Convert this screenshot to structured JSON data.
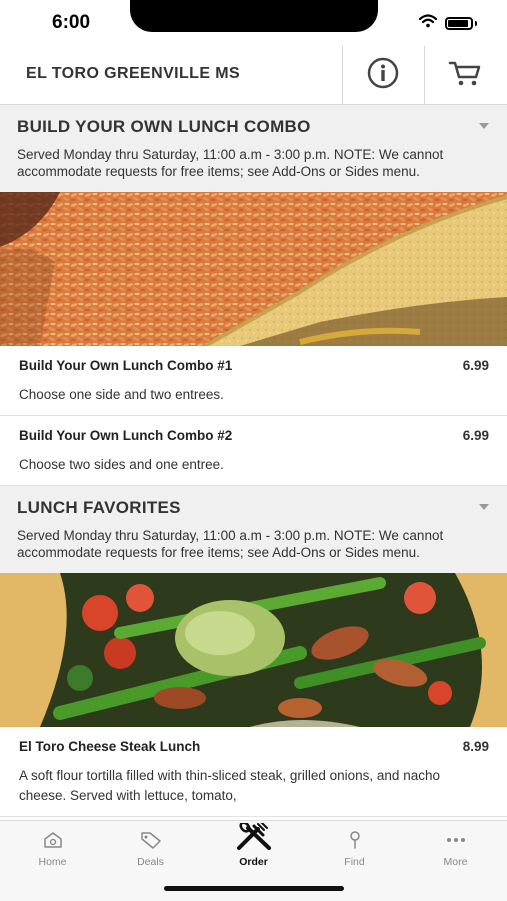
{
  "status_bar": {
    "time": "6:00"
  },
  "header": {
    "title": "EL TORO GREENVILLE MS",
    "info_icon": "info-icon",
    "cart_icon": "cart-icon"
  },
  "sections": [
    {
      "title": "BUILD YOUR OWN LUNCH COMBO",
      "description": "Served Monday thru Saturday, 11:00 a.m - 3:00 p.m. NOTE: We cannot accommodate requests for free items; see Add-Ons or Sides menu.",
      "items": [
        {
          "name": "Build Your Own Lunch Combo #1",
          "price": "6.99",
          "description": "Choose one side and two entrees."
        },
        {
          "name": "Build Your Own Lunch Combo #2",
          "price": "6.99",
          "description": "Choose two sides and one entree."
        }
      ]
    },
    {
      "title": "LUNCH FAVORITES",
      "description": "Served Monday thru Saturday, 11:00 a.m - 3:00 p.m. NOTE: We cannot accommodate requests for free items; see Add-Ons or Sides menu.",
      "items": [
        {
          "name": "El Toro Cheese Steak Lunch",
          "price": "8.99",
          "description": "A soft flour tortilla filled with thin-sliced steak, grilled onions, and nacho cheese. Served with lettuce, tomato,"
        }
      ]
    }
  ],
  "tabs": [
    {
      "label": "Home",
      "icon": "home-icon"
    },
    {
      "label": "Deals",
      "icon": "tag-icon"
    },
    {
      "label": "Order",
      "icon": "utensils-icon",
      "active": true
    },
    {
      "label": "Find",
      "icon": "location-pin-icon"
    },
    {
      "label": "More",
      "icon": "more-dots-icon"
    }
  ],
  "colors": {
    "section_bg": "#f0f0f0",
    "active_tab": "#111111",
    "inactive_tab": "#888888"
  }
}
